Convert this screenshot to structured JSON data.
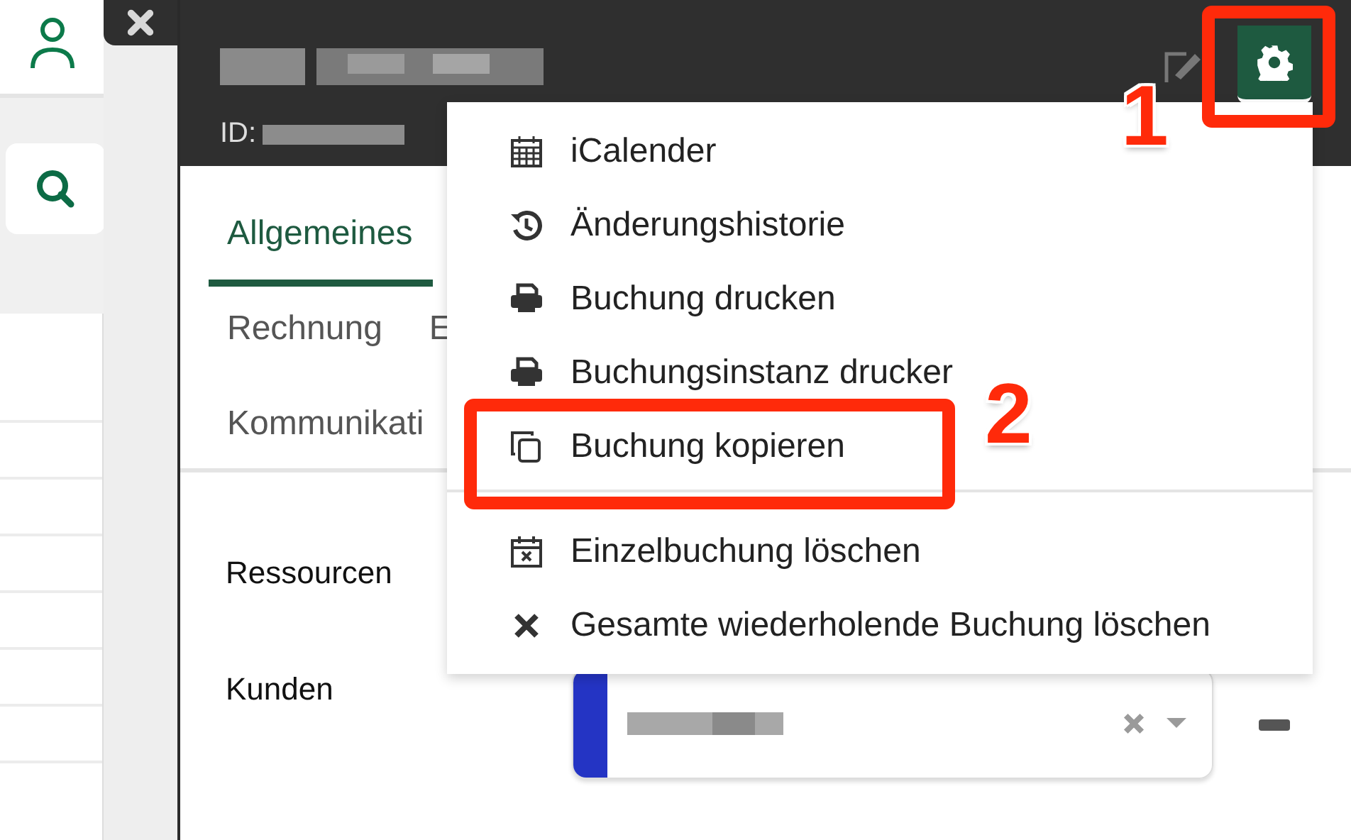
{
  "header": {
    "id_label": "ID:"
  },
  "tab_rows": [
    [
      {
        "label": "Allgemeines",
        "selected": true
      }
    ],
    [
      {
        "label": "Rechnung",
        "selected": false
      },
      {
        "label": "E",
        "selected": false
      }
    ],
    [
      {
        "label": "Kommunikati",
        "selected": false
      }
    ]
  ],
  "form": {
    "fields": [
      {
        "label": "Ressourcen"
      },
      {
        "label": "Kunden"
      }
    ]
  },
  "menu": {
    "sections": [
      [
        {
          "label": "iCalender",
          "kind": "calendar"
        },
        {
          "label": "Änderungshistorie",
          "kind": "history"
        },
        {
          "label": "Buchung drucken",
          "kind": "print"
        },
        {
          "label": "Buchungsinstanz drucker",
          "kind": "print"
        },
        {
          "label": "Buchung kopieren",
          "kind": "copy"
        }
      ],
      [
        {
          "label": "Einzelbuchung löschen",
          "kind": "calendar-x"
        },
        {
          "label": "Gesamte wiederholende Buchung löschen",
          "kind": "x"
        }
      ]
    ]
  },
  "annotations": [
    {
      "label": "1"
    },
    {
      "label": "2"
    }
  ]
}
